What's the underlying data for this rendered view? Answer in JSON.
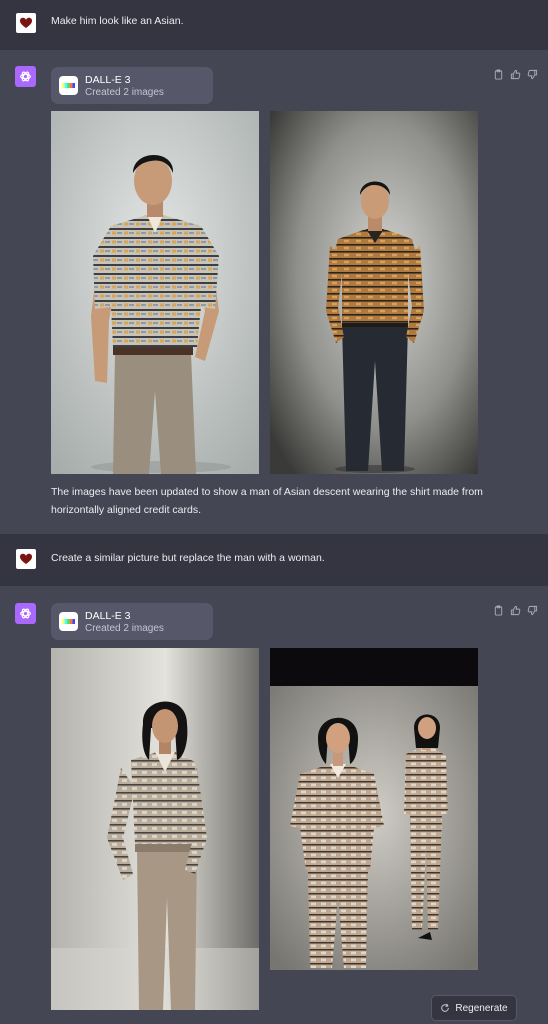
{
  "conversation": [
    {
      "role": "user",
      "text": "Make him look like an Asian."
    },
    {
      "role": "assistant",
      "tool": {
        "name": "DALL-E 3",
        "status": "Created 2 images"
      },
      "caption": "The images have been updated to show a man of Asian descent wearing the shirt made from horizontally aligned credit cards."
    },
    {
      "role": "user",
      "text": "Create a similar picture but replace the man with a woman."
    },
    {
      "role": "assistant",
      "tool": {
        "name": "DALL-E 3",
        "status": "Created 2 images"
      }
    }
  ],
  "controls": {
    "regenerate_label": "Regenerate"
  },
  "colors": {
    "user_row": "#343541",
    "assistant_row": "#444654",
    "ai_avatar": "#ab68ff",
    "chip": "#565869"
  },
  "icons": [
    "heart-avatar-icon",
    "openai-logo-icon",
    "dalle-icon",
    "clipboard-icon",
    "thumbs-up-icon",
    "thumbs-down-icon",
    "refresh-icon"
  ]
}
